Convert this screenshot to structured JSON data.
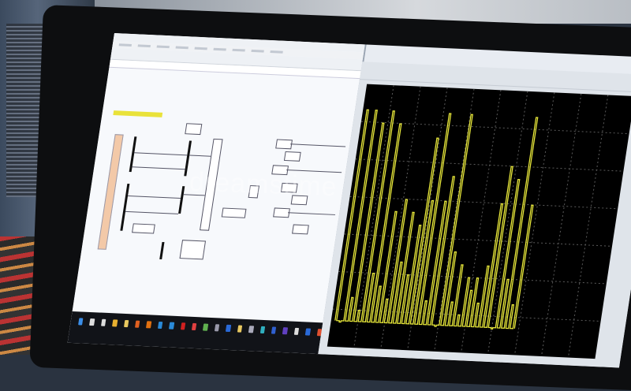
{
  "watermark": "dreamstime",
  "colors": {
    "signal": "#e8e83a",
    "grid": "#5a5a5a",
    "highlight": "#e9e23a"
  },
  "taskbar_icons": [
    "windows-start",
    "search",
    "cortana",
    "chrome",
    "file-explorer",
    "matlab",
    "app-orange",
    "app-blue",
    "app-blue2",
    "acrobat",
    "app-red",
    "app-green",
    "app-gray",
    "app-m",
    "app-yellow",
    "app-docs",
    "app-teal",
    "app-save",
    "app-purple",
    "photos",
    "app-word",
    "app-edge"
  ],
  "scope_signal": [
    0.95,
    0.1,
    0.95,
    0.2,
    0.9,
    0.15,
    0.95,
    0.3,
    0.9,
    0.25,
    0.55,
    0.2,
    0.6,
    0.35,
    0.55,
    0.3,
    0.5,
    0.85,
    0.6,
    0.95,
    0.2,
    0.6,
    0.7,
    0.1,
    0.95,
    0.4,
    0.2,
    0.35,
    0.15,
    0.3,
    0.25,
    0.3,
    0.2,
    0.35,
    0.6,
    0.75,
    0.1,
    0.7,
    0.3,
    0.95,
    0.2,
    0.6
  ]
}
